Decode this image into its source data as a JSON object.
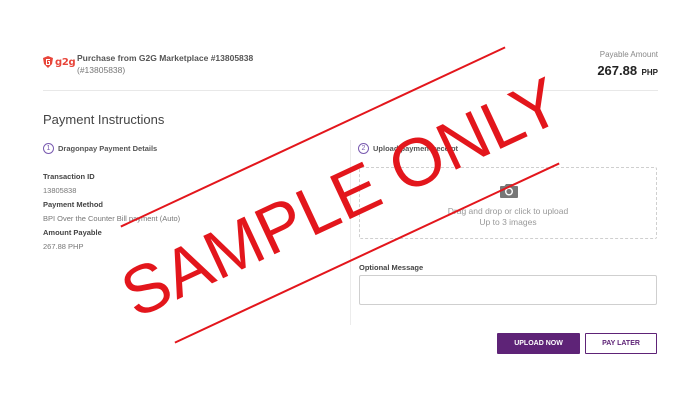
{
  "header": {
    "logo_text": "g2g",
    "purchase_title": "Purchase from G2G Marketplace #13805838",
    "purchase_subtitle": "(#13805838)",
    "payable_label": "Payable Amount",
    "payable_amount": "267.88",
    "payable_currency": "PHP"
  },
  "main": {
    "section_title": "Payment Instructions",
    "steps": [
      {
        "number": "1",
        "label": "Dragonpay Payment Details"
      },
      {
        "number": "2",
        "label": "Upload payment receipt"
      }
    ],
    "details": [
      {
        "label": "Transaction ID",
        "value": "13805838"
      },
      {
        "label": "Payment Method",
        "value": "BPI Over the Counter Bill payment (Auto)"
      },
      {
        "label": "Amount Payable",
        "value": "267.88 PHP"
      }
    ],
    "dropzone": {
      "icon": "camera-icon",
      "line1": "Drag and drop or click to upload",
      "line2": "Up to 3 images"
    },
    "optional_message_label": "Optional Message",
    "buttons": {
      "upload": "UPLOAD NOW",
      "pay_later": "PAY LATER"
    }
  },
  "watermark": {
    "text": "SAMPLE ONLY",
    "color": "#e3161c"
  },
  "colors": {
    "accent": "#5e2377",
    "brand": "#e8463b"
  }
}
